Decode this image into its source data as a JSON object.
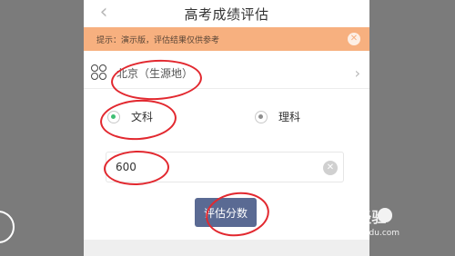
{
  "app": {
    "title": "高考成绩评估"
  },
  "notice": {
    "text": "提示：演示版，评估结果仅供参考"
  },
  "region": {
    "label": "北京（生源地）"
  },
  "subjects": [
    {
      "label": "文科",
      "selected": true
    },
    {
      "label": "理科",
      "selected": false
    }
  ],
  "score": {
    "value": "600"
  },
  "submit": {
    "label": "评估分数"
  },
  "watermark": {
    "text": "Bai 经验",
    "sub": "jingyan.baidu.com"
  },
  "colors": {
    "notice_bg": "#f7b07f",
    "button_bg": "#5a6a93",
    "radio_selected": "#3fbf74",
    "annotation": "#e2282f"
  }
}
